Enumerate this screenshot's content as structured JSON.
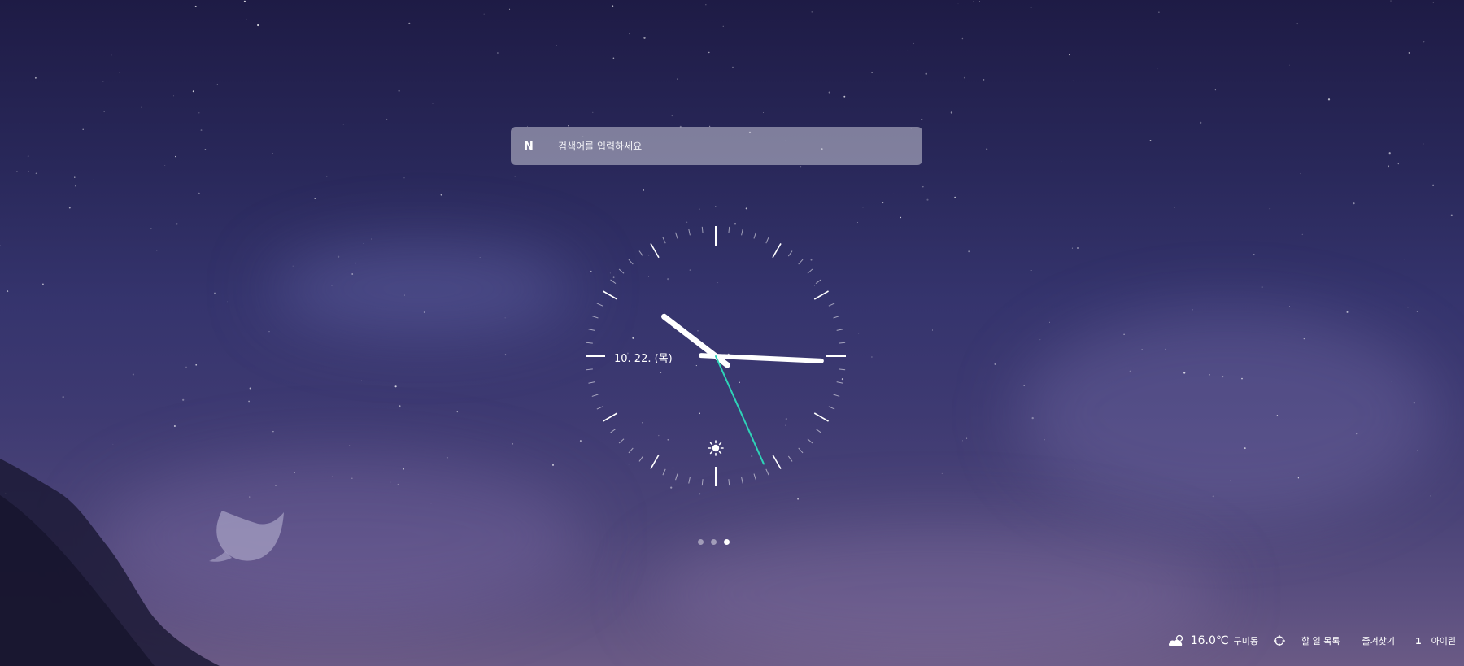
{
  "search": {
    "logo": "N",
    "placeholder": "검색어를 입력하세요"
  },
  "clock": {
    "date": "10. 22. (목)",
    "hour": 10,
    "minute": 15,
    "second": 26,
    "weather_icon": "sun-icon",
    "second_hand_color": "#2ed3b7"
  },
  "pagination": {
    "total": 3,
    "active": 3
  },
  "bottom_bar": {
    "weather": {
      "icon": "cloud-icon",
      "temperature": "16.0℃",
      "location": "구미동"
    },
    "location_icon": "crosshair-icon",
    "todo_label": "할 일 목록",
    "bookmarks_label": "즐겨찾기",
    "account_count": "1",
    "account_label": "아이린"
  }
}
